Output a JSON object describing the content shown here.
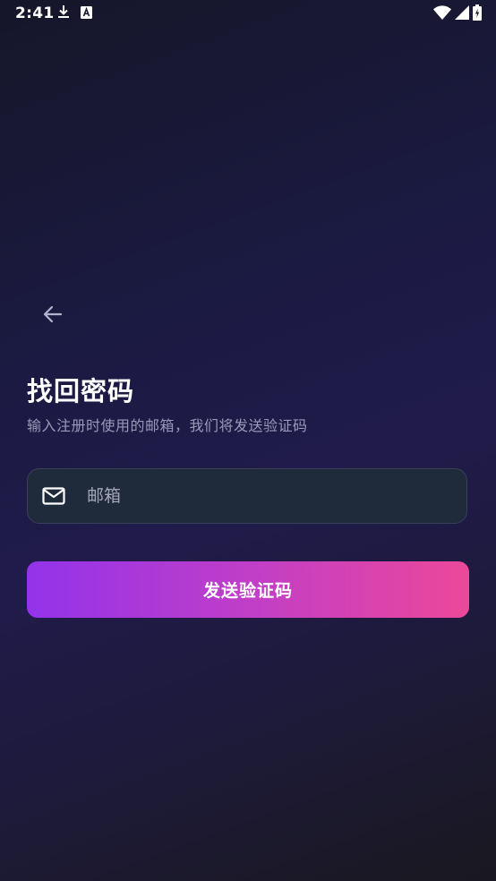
{
  "status_bar": {
    "time": "2:41",
    "left_icons": [
      "download-icon",
      "keyboard-a-icon"
    ],
    "right_icons": [
      "wifi-icon",
      "signal-icon",
      "battery-icon"
    ]
  },
  "header": {
    "back_icon": "arrow-left-icon"
  },
  "main": {
    "title": "找回密码",
    "subtitle": "输入注册时使用的邮箱，我们将发送验证码",
    "email_field": {
      "icon": "mail-icon",
      "value": "",
      "placeholder": "邮箱"
    },
    "send_button_label": "发送验证码"
  },
  "colors": {
    "accent_start": "#9333ea",
    "accent_end": "#ec4899",
    "field_bg": "#1f2a3b",
    "subtitle_text": "#9a98b8"
  }
}
